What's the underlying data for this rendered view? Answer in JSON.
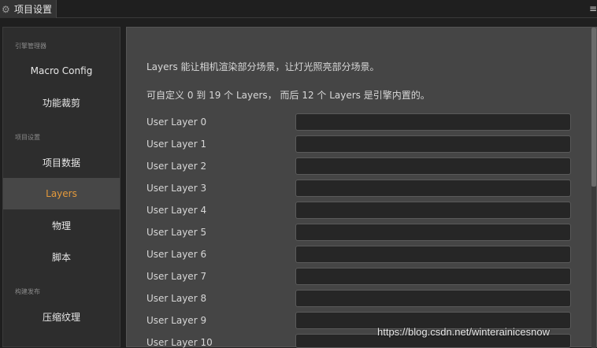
{
  "tab": {
    "icon": "gear-icon",
    "title": "项目设置"
  },
  "menu_icon": "≡",
  "sidebar": {
    "sections": [
      {
        "label": "引擎管理器",
        "items": [
          "Macro Config",
          "功能裁剪"
        ]
      },
      {
        "label": "项目设置",
        "items": [
          "项目数据",
          "Layers",
          "物理",
          "脚本"
        ]
      },
      {
        "label": "构建发布",
        "items": [
          "压缩纹理"
        ]
      }
    ],
    "active": "Layers"
  },
  "main": {
    "desc1": "Layers 能让相机渲染部分场景，让灯光照亮部分场景。",
    "desc2": "可自定义 0 到 19 个 Layers， 而后 12 个 Layers 是引擎内置的。",
    "layers": [
      {
        "label": "User Layer 0",
        "value": ""
      },
      {
        "label": "User Layer 1",
        "value": ""
      },
      {
        "label": "User Layer 2",
        "value": ""
      },
      {
        "label": "User Layer 3",
        "value": ""
      },
      {
        "label": "User Layer 4",
        "value": ""
      },
      {
        "label": "User Layer 5",
        "value": ""
      },
      {
        "label": "User Layer 6",
        "value": ""
      },
      {
        "label": "User Layer 7",
        "value": ""
      },
      {
        "label": "User Layer 8",
        "value": ""
      },
      {
        "label": "User Layer 9",
        "value": ""
      },
      {
        "label": "User Layer 10",
        "value": ""
      }
    ]
  },
  "watermark": "https://blog.csdn.net/winterainicesnow",
  "colors": {
    "accent": "#e59a3b",
    "panel": "#454545",
    "sidebar": "#2d2d2d"
  }
}
